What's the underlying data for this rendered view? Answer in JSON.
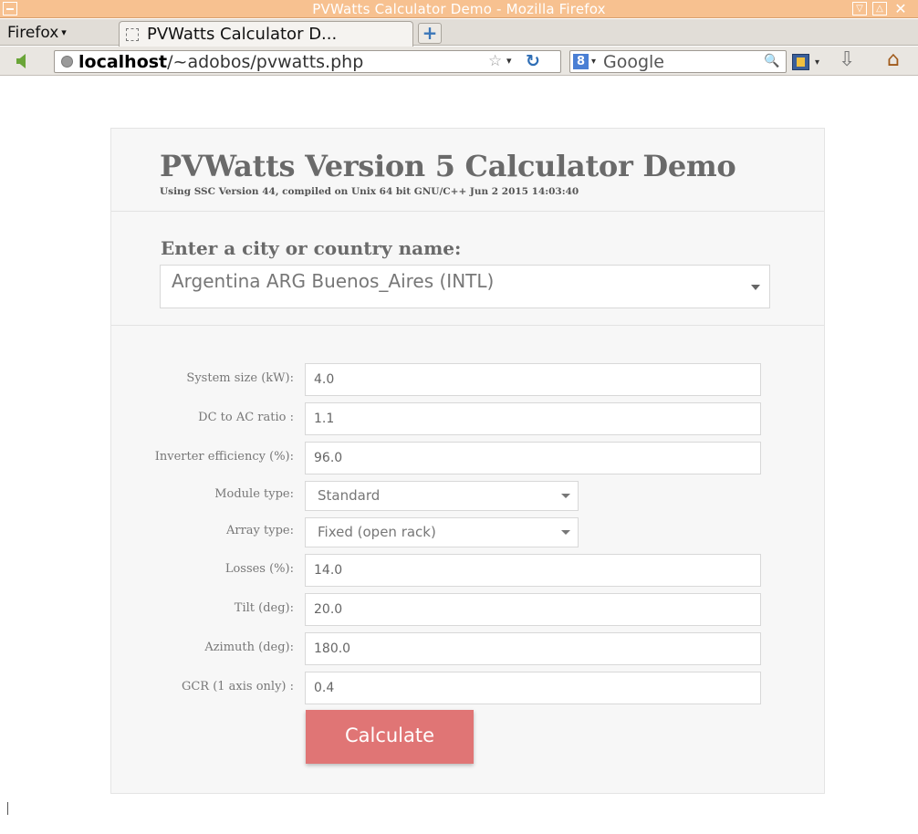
{
  "window": {
    "title": "PVWatts Calculator Demo - Mozilla Firefox",
    "minimize_glyph": "▽",
    "maximize_glyph": "△",
    "close_glyph": "✕"
  },
  "tabstrip": {
    "menu_label": "Firefox",
    "menu_caret": "▾",
    "active_tab_label": "PVWatts Calculator D...",
    "new_tab_glyph": "+"
  },
  "navbar": {
    "url_host": "localhost",
    "url_path": "/~adobos/pvwatts.php",
    "star_glyph": "☆",
    "dropdown_glyph": "▾",
    "reload_glyph": "↻",
    "search_engine": "Google",
    "search_engine_badge": "8",
    "search_caret": "▾",
    "search_glyph": "🔍",
    "bookmarks_caret": "▾",
    "download_glyph": "⇩",
    "home_glyph": "⌂"
  },
  "header": {
    "title": "PVWatts Version 5 Calculator Demo",
    "subtitle": "Using SSC Version 44, compiled on Unix 64 bit GNU/C++ Jun 2 2015 14:03:40"
  },
  "location": {
    "label": "Enter a city or country name:",
    "selected": "Argentina ARG Buenos_Aires (INTL)"
  },
  "form": {
    "system_size": {
      "label": "System size (kW):",
      "value": "4.0"
    },
    "dc_ac_ratio": {
      "label": "DC to AC ratio :",
      "value": "1.1"
    },
    "inverter_efficiency": {
      "label": "Inverter efficiency (%):",
      "value": "96.0"
    },
    "module_type": {
      "label": "Module type:",
      "value": "Standard"
    },
    "array_type": {
      "label": "Array type:",
      "value": "Fixed (open rack)"
    },
    "losses": {
      "label": "Losses (%):",
      "value": "14.0"
    },
    "tilt": {
      "label": "Tilt (deg):",
      "value": "20.0"
    },
    "azimuth": {
      "label": "Azimuth (deg):",
      "value": "180.0"
    },
    "gcr": {
      "label": "GCR (1 axis only) :",
      "value": "0.4"
    },
    "calculate_label": "Calculate"
  },
  "colors": {
    "titlebar": "#f7c190",
    "calculate_button": "#e07575",
    "card_background": "#f7f7f7"
  }
}
